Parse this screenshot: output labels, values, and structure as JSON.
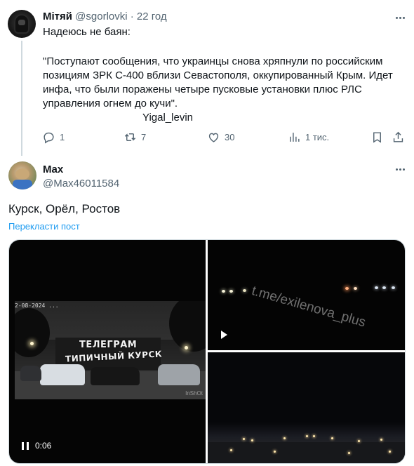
{
  "tweet1": {
    "author_name": "Мітяй",
    "author_handle": "@sgorlovki",
    "separator": "·",
    "time": "22 год",
    "lines": [
      "Надеюсь не баян:",
      "\"Поступают сообщения, что украинцы снова хряпнули по российским",
      "позициям ЗРК С-400 вблизи Севастополя, оккупированный Крым. Идет",
      "инфа, что были поражены четыре пусковые установки плюс РЛС",
      "управления огнем до кучи\".",
      "Yigal_levin"
    ],
    "stats": {
      "replies": "1",
      "reposts": "7",
      "likes": "30",
      "views": "1 тис."
    },
    "icons": [
      "reply-icon",
      "repost-icon",
      "like-icon",
      "views-icon",
      "bookmark-icon",
      "share-icon",
      "more-icon"
    ]
  },
  "tweet2": {
    "author_name": "Max",
    "author_handle": "@Max46011584",
    "text": "Курск, Орёл, Ростов",
    "translate_label": "Перекласти пост",
    "video1": {
      "timestamp": "2-08-2024  ...",
      "sign_line1": "ТЕЛЕГРАМ",
      "sign_line2": "ТИПИЧНЫЙ КУРСК",
      "watermark": "InShOt",
      "elapsed": "0:06"
    },
    "video2": {
      "watermark": "t.me/exilenova_plus"
    },
    "icons": [
      "more-icon",
      "pause-icon",
      "play-icon"
    ]
  },
  "colors": {
    "link": "#1d9bf0",
    "secondary_text": "#536471",
    "primary_text": "#0f1419",
    "divider": "#cfd9de"
  }
}
